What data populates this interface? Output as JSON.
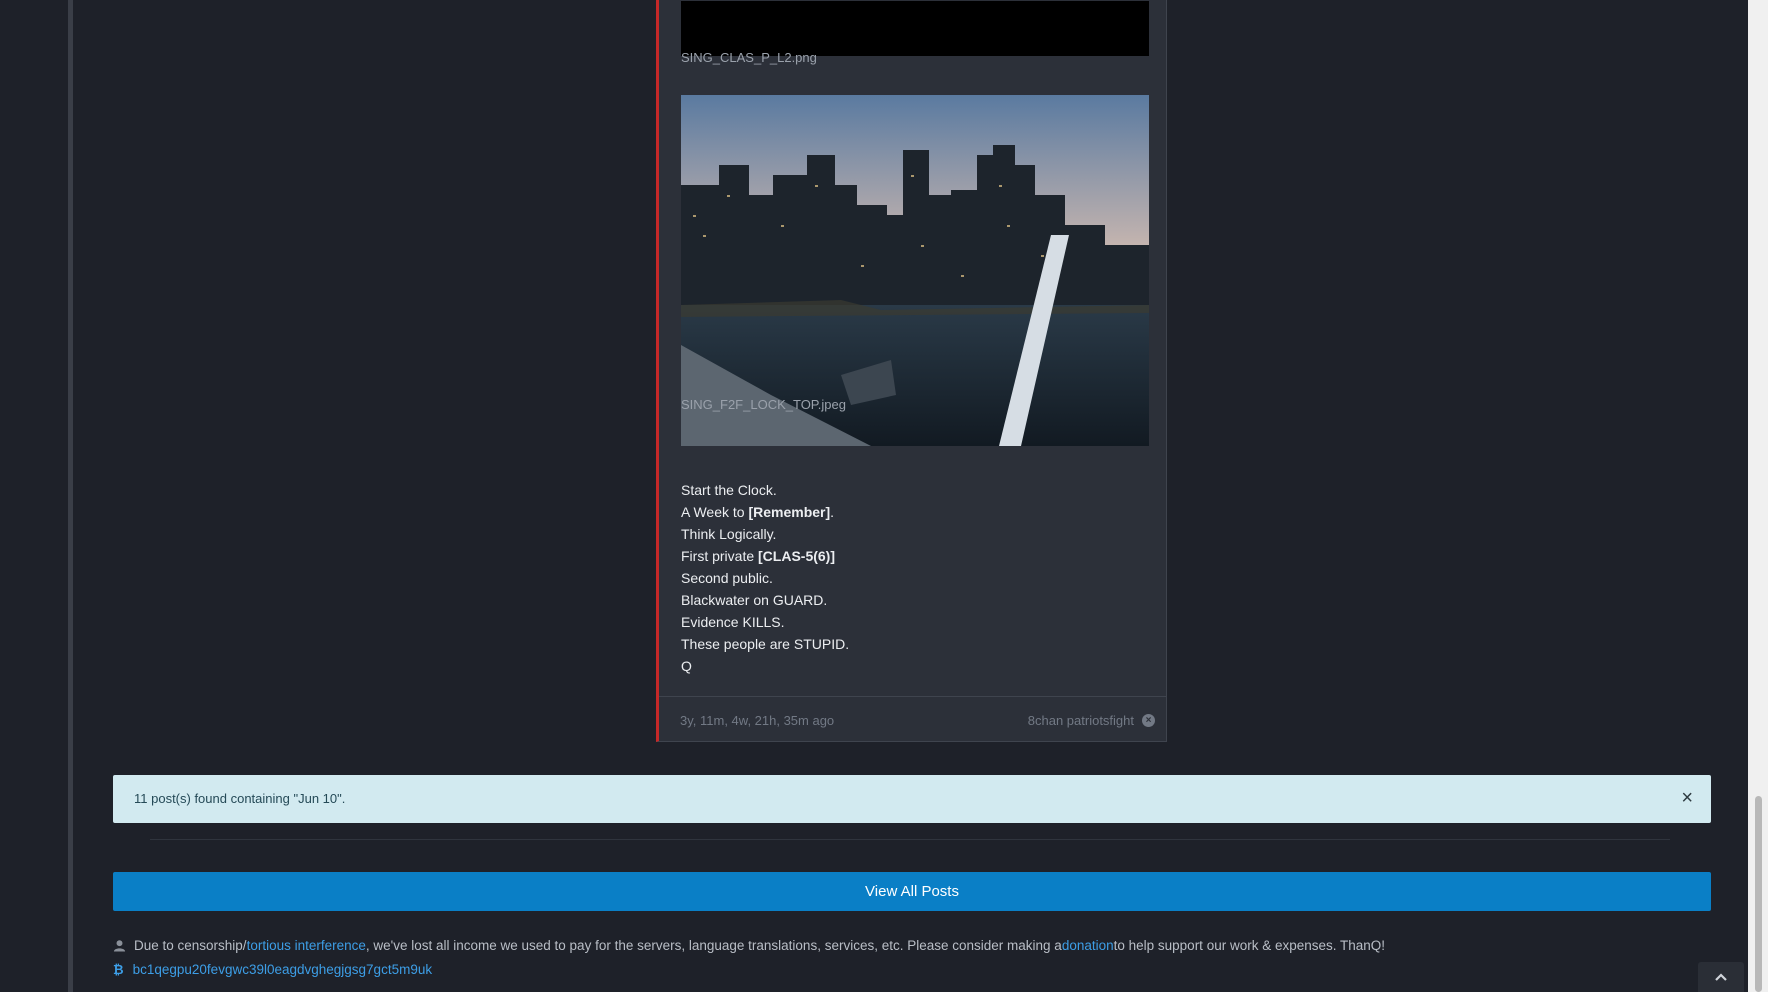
{
  "post": {
    "files": [
      {
        "name": "SING_CLAS_P_L2.png"
      },
      {
        "name": "SING_F2F_LOCK_TOP.jpeg"
      }
    ],
    "lines": {
      "l1": "Start the Clock.",
      "l2_pre": "A Week to ",
      "l2_bold": "[Remember]",
      "l2_post": ".",
      "l3": "Think Logically.",
      "l4_pre": "First private ",
      "l4_bold": "[CLAS-5(6)]",
      "l5": "Second public.",
      "l6": "Blackwater on GUARD.",
      "l7": "Evidence KILLS.",
      "l8": "These people are STUPID.",
      "l9": "Q"
    },
    "time_ago": "3y, 11m, 4w, 21h, 35m ago",
    "source": "8chan patriotsfight",
    "source_icon": "close-circle-icon"
  },
  "alert": {
    "message": "11 post(s) found containing \"Jun 10\".",
    "close_glyph": "×"
  },
  "view_all_label": "View All Posts",
  "notice": {
    "pre": "Due to censorship/",
    "link1": "tortious interference",
    "mid": ", we've lost all income we used to pay for the servers, language translations, services, etc. Please consider making a ",
    "link2": "donation",
    "post": " to help support our work & expenses. ThanQ!"
  },
  "btc": {
    "icon_glyph": "₿",
    "address": "bc1qegpu20fevgwc39l0eagdvghegjgsg7gct5m9uk"
  },
  "colors": {
    "background": "#1e2129",
    "post_bg": "#2c3039",
    "post_accent": "#c62828",
    "alert_bg": "#d2eaf0",
    "primary_button": "#0a7fc6",
    "link": "#3d9ee6"
  }
}
